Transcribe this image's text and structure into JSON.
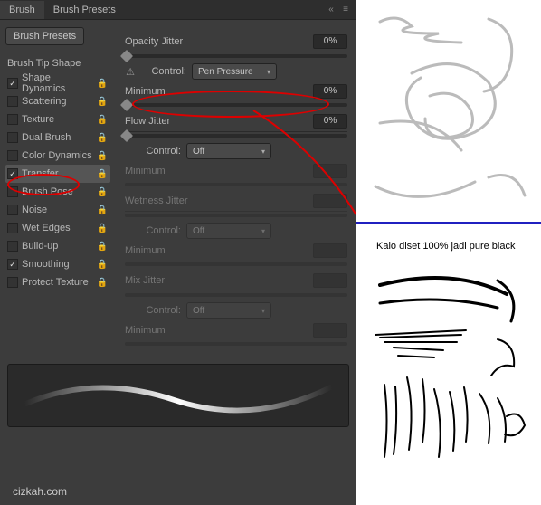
{
  "tabs": {
    "brush": "Brush",
    "presets": "Brush Presets"
  },
  "sidebar": {
    "presets_btn": "Brush Presets",
    "tip_shape": "Brush Tip Shape",
    "items": [
      {
        "label": "Shape Dynamics",
        "checked": true,
        "selected": false
      },
      {
        "label": "Scattering",
        "checked": false,
        "selected": false
      },
      {
        "label": "Texture",
        "checked": false,
        "selected": false
      },
      {
        "label": "Dual Brush",
        "checked": false,
        "selected": false
      },
      {
        "label": "Color Dynamics",
        "checked": false,
        "selected": false
      },
      {
        "label": "Transfer",
        "checked": true,
        "selected": true
      },
      {
        "label": "Brush Pose",
        "checked": false,
        "selected": false
      },
      {
        "label": "Noise",
        "checked": false,
        "selected": false
      },
      {
        "label": "Wet Edges",
        "checked": false,
        "selected": false
      },
      {
        "label": "Build-up",
        "checked": false,
        "selected": false
      },
      {
        "label": "Smoothing",
        "checked": true,
        "selected": false
      },
      {
        "label": "Protect Texture",
        "checked": false,
        "selected": false
      }
    ]
  },
  "settings": {
    "opacity_jitter": {
      "label": "Opacity Jitter",
      "value": "0%"
    },
    "opacity_control": {
      "label": "Control:",
      "value": "Pen Pressure"
    },
    "opacity_min": {
      "label": "Minimum",
      "value": "0%"
    },
    "flow_jitter": {
      "label": "Flow Jitter",
      "value": "0%"
    },
    "flow_control": {
      "label": "Control:",
      "value": "Off"
    },
    "flow_min": {
      "label": "Minimum"
    },
    "wetness_jitter": {
      "label": "Wetness Jitter"
    },
    "wetness_control": {
      "label": "Control:",
      "value": "Off"
    },
    "wetness_min": {
      "label": "Minimum"
    },
    "mix_jitter": {
      "label": "Mix Jitter"
    },
    "mix_control": {
      "label": "Control:",
      "value": "Off"
    },
    "mix_min": {
      "label": "Minimum"
    }
  },
  "annotation": {
    "caption": "Kalo diset 100% jadi pure black"
  },
  "watermark": "cizkah.com"
}
